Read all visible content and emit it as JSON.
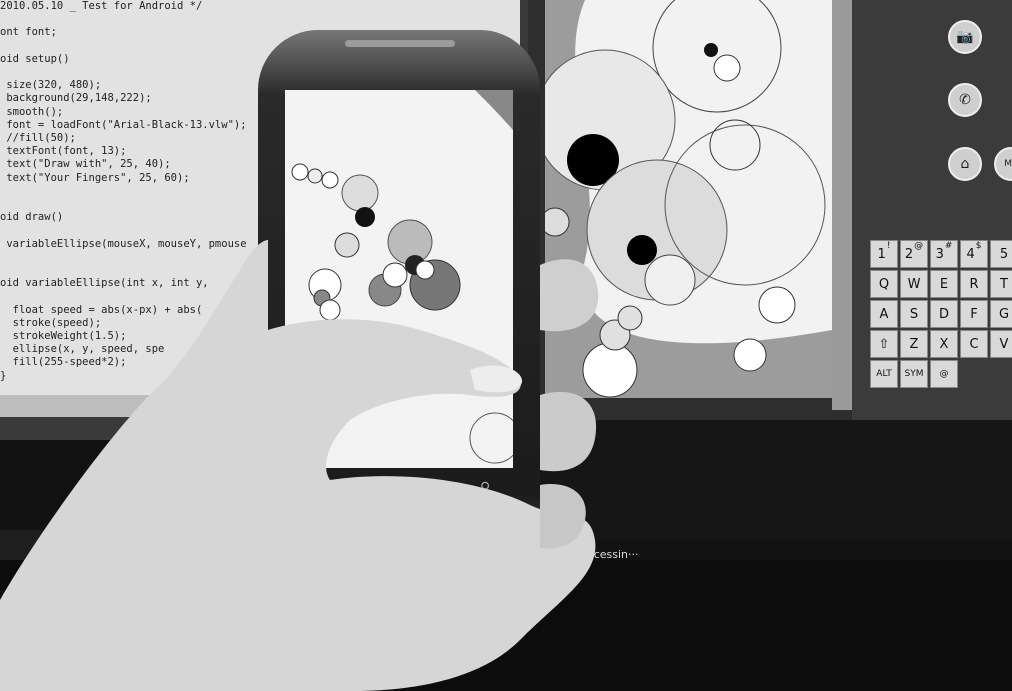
{
  "editor": {
    "lines": [
      "2010.05.10 _ Test for Android */",
      "",
      "ont font;",
      "",
      "oid setup()",
      "",
      " size(320, 480);",
      " background(29,148,222);",
      " smooth();",
      " font = loadFont(\"Arial-Black-13.vlw\");",
      " //fill(50);",
      " textFont(font, 13);",
      " text(\"Draw with\", 25, 40);",
      " text(\"Your Fingers\", 25, 60);",
      "",
      "",
      "oid draw()",
      "",
      " variableEllipse(mouseX, mouseY, pmouse",
      "",
      "",
      "oid variableEllipse(int x, int y,",
      "",
      "  float speed = abs(x-px) + abs(",
      "  stroke(speed);",
      "  strokeWeight(1.5);",
      "  ellipse(x, y, speed, spe",
      "  fill(255-speed*2);",
      "}"
    ]
  },
  "taskbar": {
    "label": "st_0520 | Processin···"
  },
  "keyboard": {
    "row1": [
      {
        "main": "1",
        "alt": "!"
      },
      {
        "main": "2",
        "alt": "@"
      },
      {
        "main": "3",
        "alt": "#"
      },
      {
        "main": "4",
        "alt": "$"
      },
      {
        "main": "5",
        "alt": ""
      }
    ],
    "row2": [
      "Q",
      "W",
      "E",
      "R",
      "T"
    ],
    "row3": [
      "A",
      "S",
      "D",
      "F",
      "G"
    ],
    "row4": [
      "⇧",
      "Z",
      "X",
      "C",
      "V"
    ],
    "row5": [
      "ALT",
      "SYM",
      "@"
    ]
  },
  "emulator_buttons": {
    "camera": "📷",
    "call": "✆",
    "home": "⌂",
    "menu": "ME"
  },
  "phone_buttons": {
    "menu": "☰",
    "home": "⌂",
    "search": "⚲"
  }
}
